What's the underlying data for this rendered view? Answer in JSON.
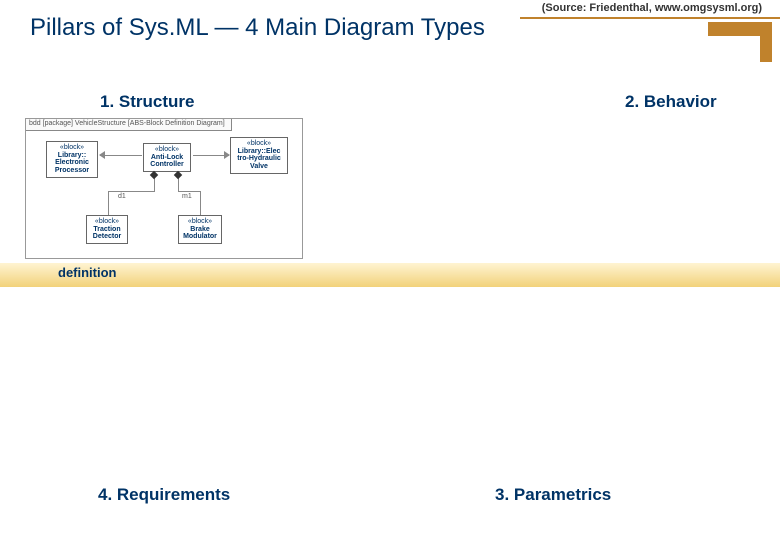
{
  "source_text": "(Source: Friedenthal, www.omgsysml.org)",
  "title": "Pillars of Sys.ML — 4 Main Diagram Types",
  "pillars": {
    "structure": "1. Structure",
    "behavior": "2. Behavior",
    "parametrics": "3. Parametrics",
    "requirements": "4. Requirements"
  },
  "definition_label": "definition",
  "bdd": {
    "frame": "bdd [package] VehicleStructure [ABS-Block Definition Diagram]",
    "stereotype": "«block»",
    "blocks": {
      "processor": "Library::\nElectronic\nProcessor",
      "controller": "Anti-Lock\nController",
      "valve": "Library::Elec\ntro-Hydraulic\nValve",
      "detector": "Traction\nDetector",
      "modulator": "Brake\nModulator"
    },
    "roles": {
      "d1": "d1",
      "m1": "m1"
    }
  }
}
